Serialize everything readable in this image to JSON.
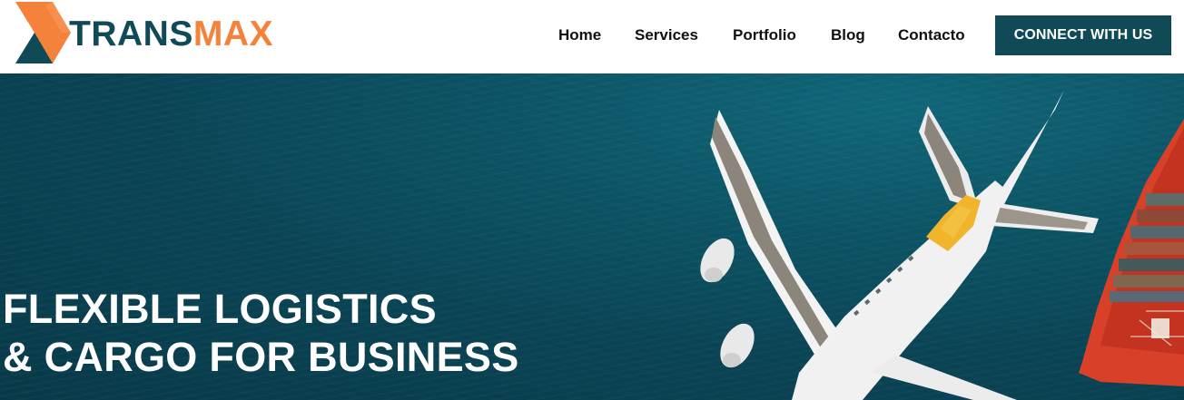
{
  "brand": {
    "name_part1": "TRANS",
    "name_part2": "MAX",
    "primary_color": "#0f4a56",
    "accent_color": "#f5823b",
    "logo_icon": "chevron-arrow-logo-icon"
  },
  "nav": {
    "items": [
      {
        "label": "Home"
      },
      {
        "label": "Services"
      },
      {
        "label": "Portfolio"
      },
      {
        "label": "Blog"
      },
      {
        "label": "Contacto"
      }
    ],
    "cta_label": "CONNECT WITH US"
  },
  "hero": {
    "headline_line1": "FLEXIBLE LOGISTICS",
    "headline_line2": "& CARGO FOR BUSINESS",
    "background_color": "#0a4556",
    "image_subjects": [
      "airplane-illustration",
      "cargo-ship-illustration"
    ]
  }
}
